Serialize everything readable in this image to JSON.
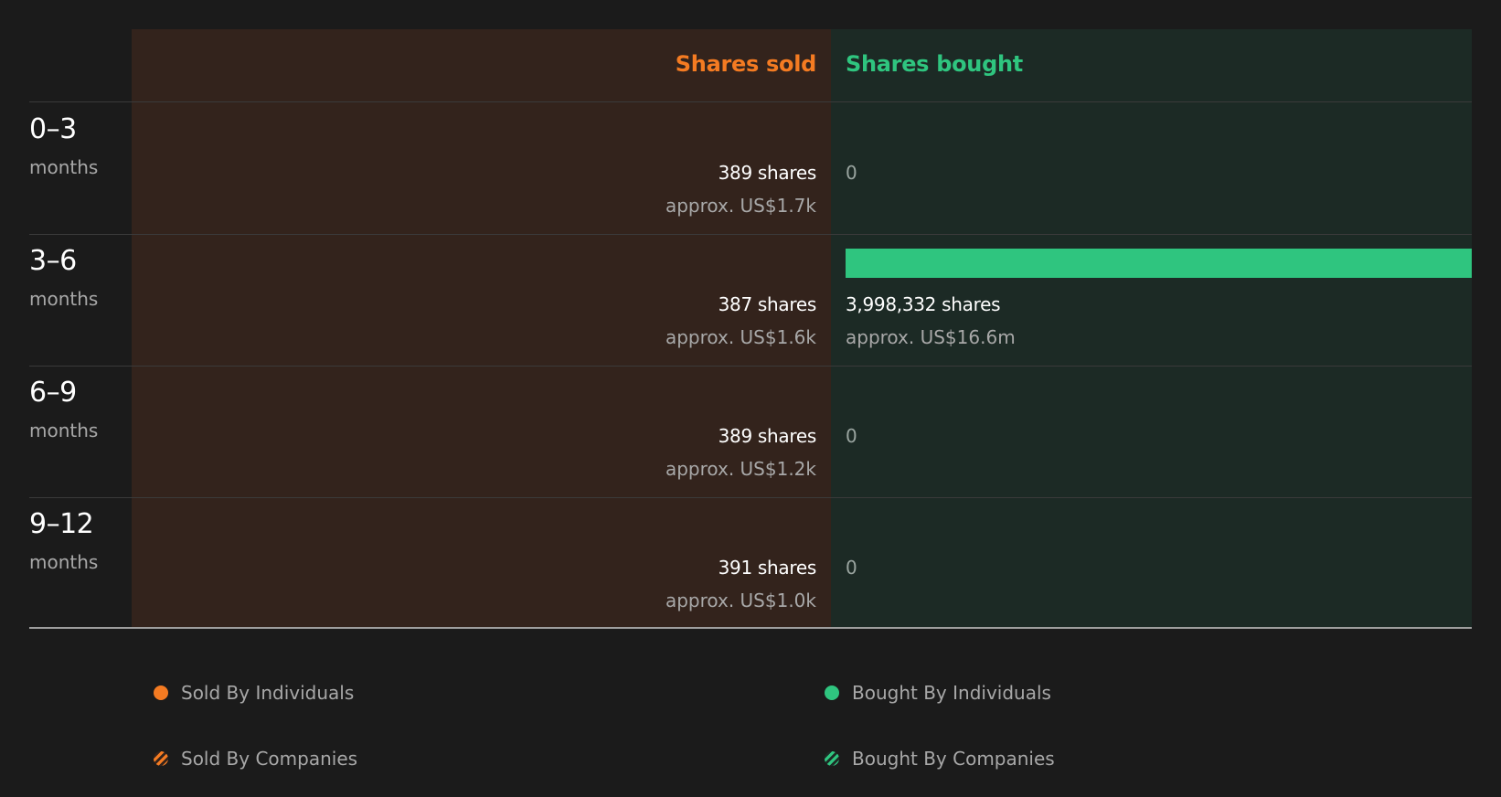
{
  "chart_data": {
    "type": "bar",
    "columns": {
      "sold": "Shares sold",
      "bought": "Shares bought"
    },
    "rows": [
      {
        "period": "0–3",
        "unit": "months",
        "sold_shares_text": "389 shares",
        "sold_value_text": "approx. US$1.7k",
        "bought_shares_text": "0",
        "bought_value_text": "",
        "sold": 389,
        "bought": 0
      },
      {
        "period": "3–6",
        "unit": "months",
        "sold_shares_text": "387 shares",
        "sold_value_text": "approx. US$1.6k",
        "bought_shares_text": "3,998,332 shares",
        "bought_value_text": "approx. US$16.6m",
        "sold": 387,
        "bought": 3998332
      },
      {
        "period": "6–9",
        "unit": "months",
        "sold_shares_text": "389 shares",
        "sold_value_text": "approx. US$1.2k",
        "bought_shares_text": "0",
        "bought_value_text": "",
        "sold": 389,
        "bought": 0
      },
      {
        "period": "9–12",
        "unit": "months",
        "sold_shares_text": "391 shares",
        "sold_value_text": "approx. US$1.0k",
        "bought_shares_text": "0",
        "bought_value_text": "",
        "sold": 391,
        "bought": 0
      }
    ],
    "max_bought": 3998332,
    "legend": [
      {
        "label": "Sold By Individuals",
        "key": "sold-individuals"
      },
      {
        "label": "Bought By Individuals",
        "key": "bought-individuals"
      },
      {
        "label": "Sold By Companies",
        "key": "sold-companies"
      },
      {
        "label": "Bought By Companies",
        "key": "bought-companies"
      }
    ],
    "colors": {
      "sold": "#f47b22",
      "bought": "#2fc57f",
      "sold_bg": "#33231c",
      "bought_bg": "#1c2a25"
    }
  }
}
